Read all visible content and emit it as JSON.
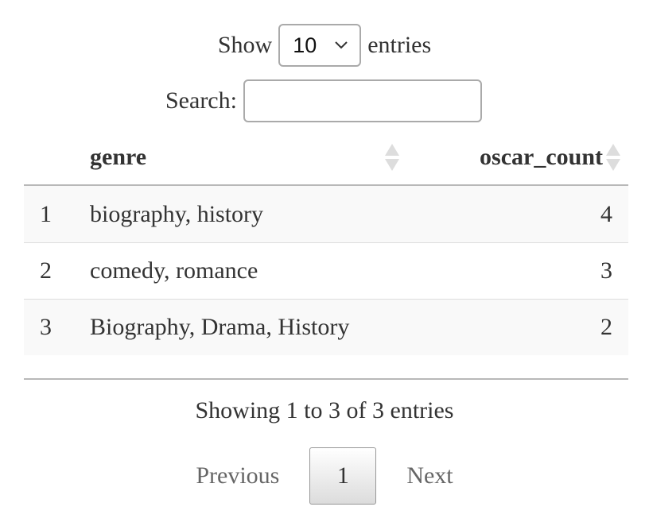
{
  "length_control": {
    "show_label": "Show",
    "selected": "10",
    "entries_label": "entries"
  },
  "search": {
    "label": "Search:",
    "value": "",
    "placeholder": ""
  },
  "table": {
    "columns": [
      "",
      "genre",
      "oscar_count"
    ],
    "rows": [
      {
        "index": "1",
        "genre": "biography, history",
        "oscar_count": "4"
      },
      {
        "index": "2",
        "genre": "comedy, romance",
        "oscar_count": "3"
      },
      {
        "index": "3",
        "genre": "Biography, Drama, History",
        "oscar_count": "2"
      }
    ]
  },
  "info": "Showing 1 to 3 of 3 entries",
  "pagination": {
    "previous": "Previous",
    "current": "1",
    "next": "Next"
  },
  "icons": {
    "select_chevron": "chevron-down-icon",
    "sort": "sort-both-icon"
  },
  "colors": {
    "border": "#aaaaaa",
    "header_rule": "#b8b8b8",
    "row_stripe": "#f9f9f9",
    "disabled_text": "#666666"
  }
}
